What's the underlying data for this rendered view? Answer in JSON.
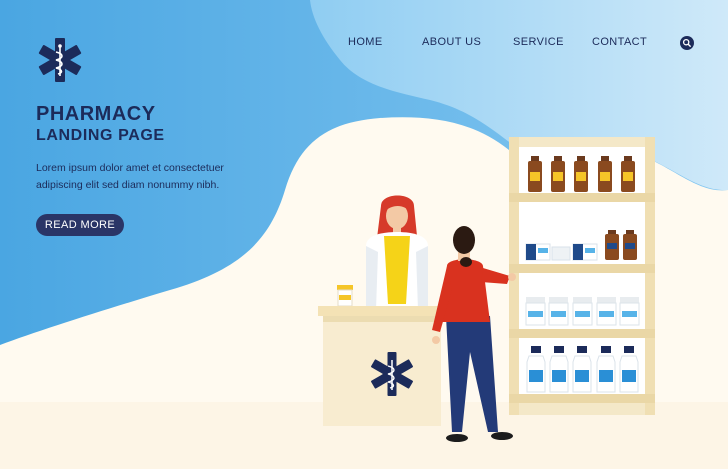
{
  "nav": {
    "items": [
      {
        "label": "HOME"
      },
      {
        "label": "ABOUT US"
      },
      {
        "label": "SERVICE"
      },
      {
        "label": "CONTACT"
      }
    ],
    "search_icon": "search-icon"
  },
  "hero": {
    "title": "PHARMACY",
    "subtitle": "LANDING PAGE",
    "body": "Lorem ipsum dolor amet et consectetuer adipiscing elit sed diam nonummy nibh.",
    "cta_label": "READ MORE"
  },
  "colors": {
    "primary_blue": "#5aaee6",
    "light_blue": "#9fd3f3",
    "navy": "#1c2b5a",
    "cream": "#fffaf0",
    "shelf": "#f4e8c8",
    "red_shirt": "#d9321f",
    "pharmacist_hair": "#d63a2a",
    "yellow": "#f5d318"
  },
  "icons": {
    "logo": "star-of-life-icon",
    "counter_emblem": "star-of-life-icon"
  }
}
